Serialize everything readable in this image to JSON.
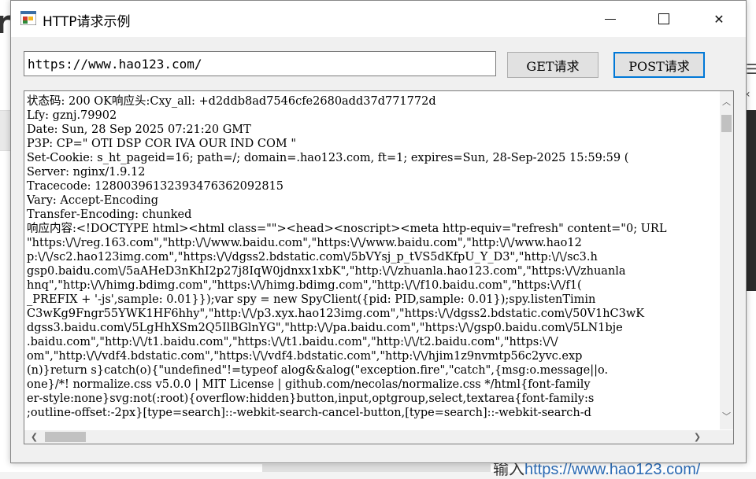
{
  "window": {
    "title": "HTTP请求示例",
    "minimize_glyph": "",
    "close_glyph": "✕"
  },
  "url_input": {
    "value": "https://www.hao123.com/"
  },
  "buttons": {
    "get_label": "GET请求",
    "post_label": "POST请求"
  },
  "output": {
    "lines": [
      "状态码: 200 OK响应头:Cxy_all: +d2ddb8ad7546cfe2680add37d771772d",
      "Lfy: gznj.79902",
      "Date: Sun, 28 Sep 2025 07:21:20 GMT",
      "P3P: CP=\" OTI DSP COR IVA OUR IND COM \"",
      "Set-Cookie: s_ht_pageid=16; path=/; domain=.hao123.com, ft=1; expires=Sun, 28-Sep-2025 15:59:59 (",
      "Server: nginx/1.9.12",
      "Tracecode: 12800396132393476362092815",
      "Vary: Accept-Encoding",
      "Transfer-Encoding: chunked",
      "响应内容:<!DOCTYPE html><html class=\"\"><head><noscript><meta http-equiv=\"refresh\" content=\"0; URL",
      "\"https:\\/\\/reg.163.com\",\"http:\\/\\/www.baidu.com\",\"https:\\/\\/www.baidu.com\",\"http:\\/\\/www.hao12",
      "p:\\/\\/sc2.hao123img.com\",\"https:\\/\\/dgss2.bdstatic.com\\/5bVYsj_p_tVS5dKfpU_Y_D3\",\"http:\\/\\/sc3.h",
      "gsp0.baidu.com\\/5aAHeD3nKhI2p27j8IqW0jdnxx1xbK\",\"http:\\/\\/zhuanla.hao123.com\",\"https:\\/\\/zhuanla",
      "hnq\",\"http:\\/\\/himg.bdimg.com\",\"https:\\/\\/himg.bdimg.com\",\"http:\\/\\/f10.baidu.com\",\"https:\\/\\/f1(",
      "_PREFIX + '-js',sample: 0.01}});var spy = new SpyClient({pid: PID,sample: 0.01});spy.listenTimin",
      "C3wKg9Fngr55YWK1HF6hhy\",\"http:\\/\\/p3.xyx.hao123img.com\",\"https:\\/\\/dgss2.bdstatic.com\\/50V1hC3wK",
      "dgss3.baidu.com\\/5LgHhXSm2Q5IlBGlnYG\",\"http:\\/\\/pa.baidu.com\",\"https:\\/\\/gsp0.baidu.com\\/5LN1bje",
      ".baidu.com\",\"http:\\/\\/t1.baidu.com\",\"https:\\/\\/t1.baidu.com\",\"http:\\/\\/t2.baidu.com\",\"https:\\/\\/",
      "om\",\"http:\\/\\/vdf4.bdstatic.com\",\"https:\\/\\/vdf4.bdstatic.com\",\"http:\\/\\/hjim1z9nvmtp56c2yvc.exp",
      "(n)}return s}catch(o){\"undefined\"!=typeof alog&&alog(\"exception.fire\",\"catch\",{msg:o.message||o.",
      "one}/*! normalize.css v5.0.0 | MIT License | github.com/necolas/normalize.css */html{font-family",
      "er-style:none}svg:not(:root){overflow:hidden}button,input,optgroup,select,textarea{font-family:s",
      ";outline-offset:-2px}[type=search]::-webkit-search-cancel-button,[type=search]::-webkit-search-d"
    ]
  },
  "scrollbars": {
    "up_glyph": "︿",
    "down_glyph": "﹀",
    "left_glyph": "❮",
    "right_glyph": "❯"
  },
  "background": {
    "bottom_text_prefix": "输入",
    "bottom_text_link": "https://www.hao123.com/"
  },
  "colors": {
    "accent": "#0078d7",
    "link": "#2d6cb5"
  },
  "icons": [
    "app-icon",
    "minimize-icon",
    "maximize-icon",
    "close-icon"
  ]
}
